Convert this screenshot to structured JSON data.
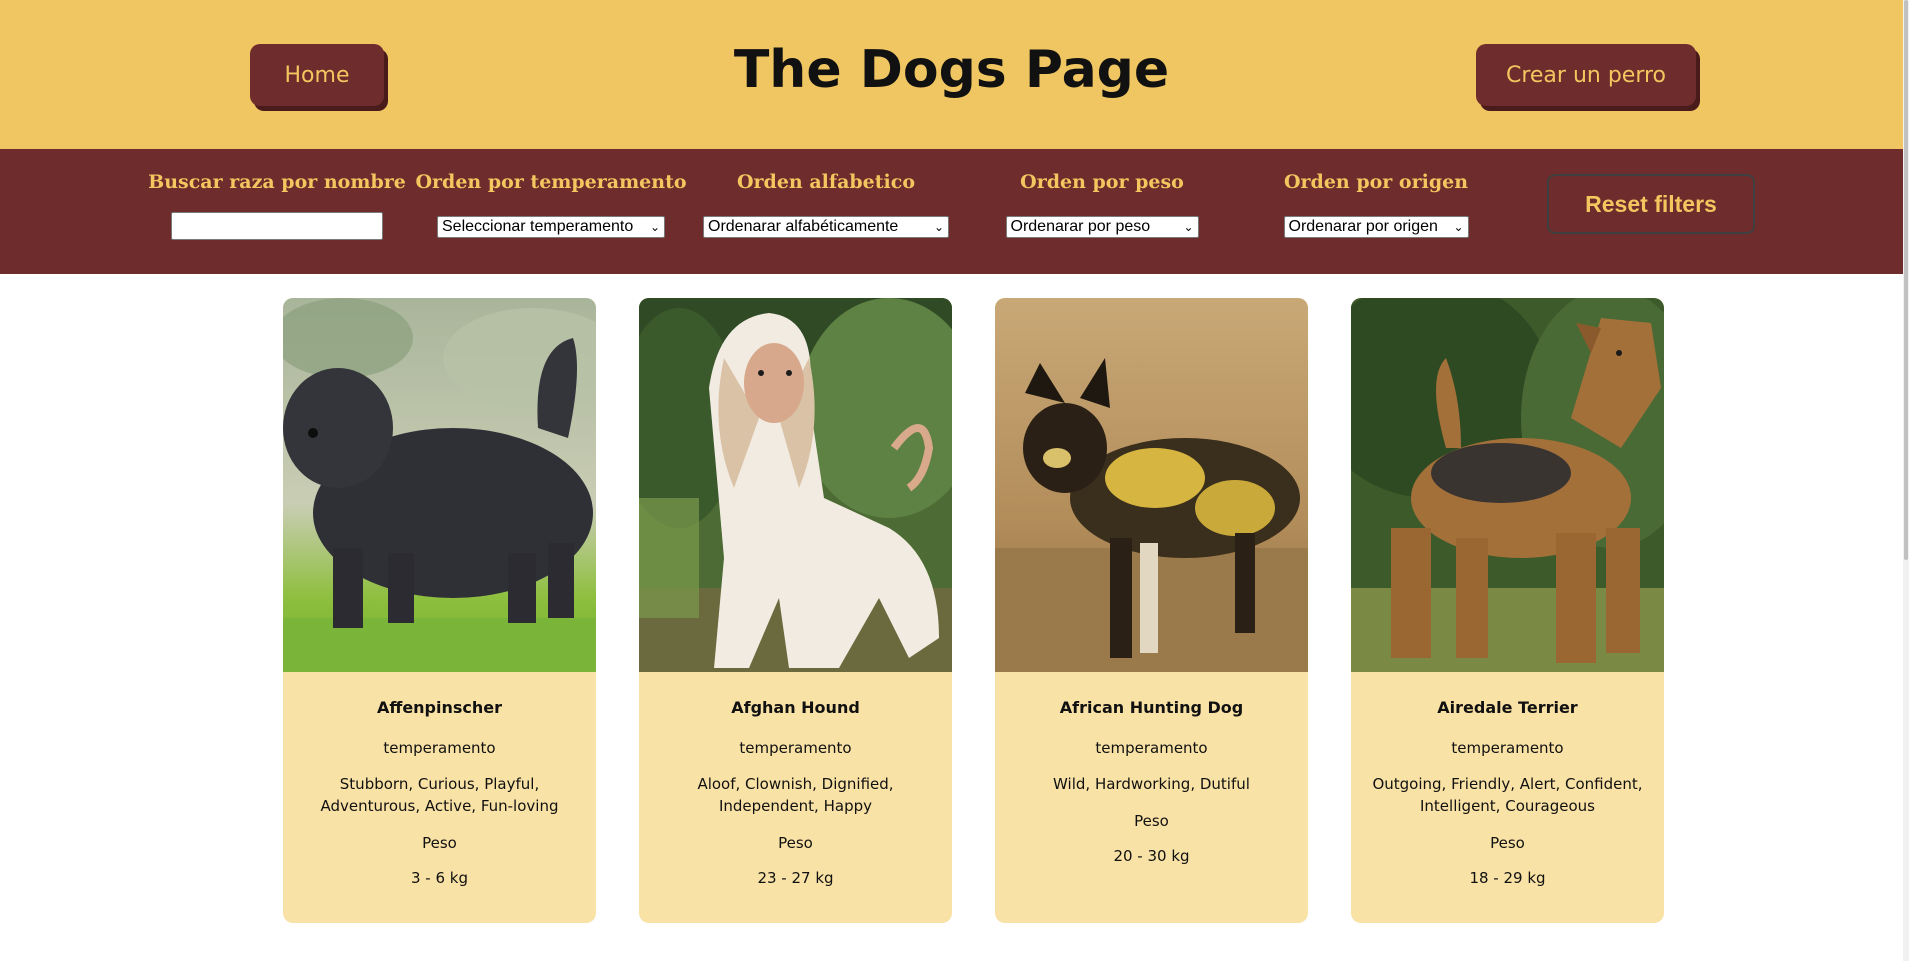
{
  "header": {
    "title": "The Dogs Page",
    "home_label": "Home",
    "create_label": "Crear un perro"
  },
  "filters": {
    "search_label": "Buscar raza por nombre",
    "search_value": "",
    "temperament_label": "Orden por temperamento",
    "temperament_selected": "Seleccionar temperamento",
    "alpha_label": "Orden alfabetico",
    "alpha_selected": "Ordenarar alfabéticamente",
    "weight_label": "Orden por peso",
    "weight_selected": "Ordenarar por peso",
    "origin_label": "Orden por origen",
    "origin_selected": "Ordenarar por origen",
    "reset_label": "Reset filters"
  },
  "cards": [
    {
      "name": "Affenpinscher",
      "temp_label": "temperamento",
      "temperaments": "Stubborn, Curious, Playful, Adventurous, Active, Fun-loving",
      "weight_label": "Peso",
      "weight": "3 - 6 kg"
    },
    {
      "name": "Afghan Hound",
      "temp_label": "temperamento",
      "temperaments": "Aloof, Clownish, Dignified, Independent, Happy",
      "weight_label": "Peso",
      "weight": "23 - 27 kg"
    },
    {
      "name": "African Hunting Dog",
      "temp_label": "temperamento",
      "temperaments": "Wild, Hardworking, Dutiful",
      "weight_label": "Peso",
      "weight": "20 - 30 kg"
    },
    {
      "name": "Airedale Terrier",
      "temp_label": "temperamento",
      "temperaments": "Outgoing, Friendly, Alert, Confident, Intelligent, Courageous",
      "weight_label": "Peso",
      "weight": "18 - 29 kg"
    }
  ],
  "colors": {
    "header_bg": "#efc661",
    "accent_dark": "#6e2c2c",
    "accent_text": "#f3c65f",
    "card_bg": "#f9e2a6"
  }
}
